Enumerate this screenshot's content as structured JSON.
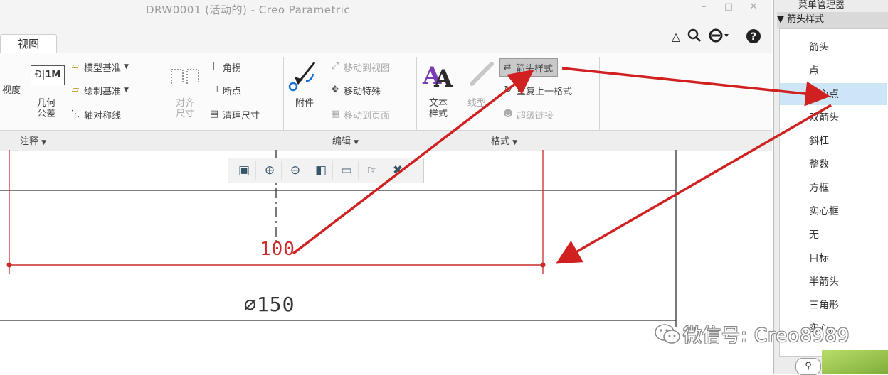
{
  "window": {
    "title": "DRW0001 (活动的) - Creo Parametric",
    "controls": [
      "–",
      "□",
      "✕"
    ]
  },
  "tabs": {
    "active": "视图"
  },
  "top_right_icons": [
    "collapse-ribbon-icon",
    "search-icon",
    "settings-icon",
    "help-icon"
  ],
  "ribbon": {
    "annotate": {
      "partial_label": "视度",
      "dim_1m": "1M",
      "geometric_tolerance": [
        "几何",
        "公差"
      ],
      "model_datum": "模型基准",
      "sketch_datum": "绘制基准",
      "symmetric_centerline": "轴对称线",
      "align_dimensions": [
        "对齐",
        "尺寸"
      ],
      "corner": "角拐",
      "breakpoint": "断点",
      "cleanup_dimensions": "清理尺寸",
      "group_label": "注释"
    },
    "edit": {
      "attach": "附件",
      "move_to_view": "移动到视图",
      "move_special": "移动特殊",
      "move_to_page": "移动到页面",
      "group_label": "编辑"
    },
    "format": {
      "text_style": [
        "文本",
        "样式"
      ],
      "line_style_partial": "线型",
      "arrow_style": "箭头样式",
      "repeat_last_format": "重复上一格式",
      "hyperlink": "超级链接",
      "group_label": "格式"
    }
  },
  "drawing": {
    "dim_100": "100",
    "dim_150": "⌀150"
  },
  "side_panel": {
    "title": "菜单管理器",
    "header": "▼ 箭头样式",
    "items": [
      "箭头",
      "点",
      "实心点",
      "双箭头",
      "斜杠",
      "整数",
      "方框",
      "实心框",
      "无",
      "目标",
      "半箭头",
      "三角形",
      "实心..."
    ],
    "selected_index": 2
  },
  "watermark": "微信号: Creo8989",
  "colors": {
    "annotation_red": "#cc2a2a",
    "arrow_red": "#d02020",
    "selection_blue": "#cde6f7"
  }
}
